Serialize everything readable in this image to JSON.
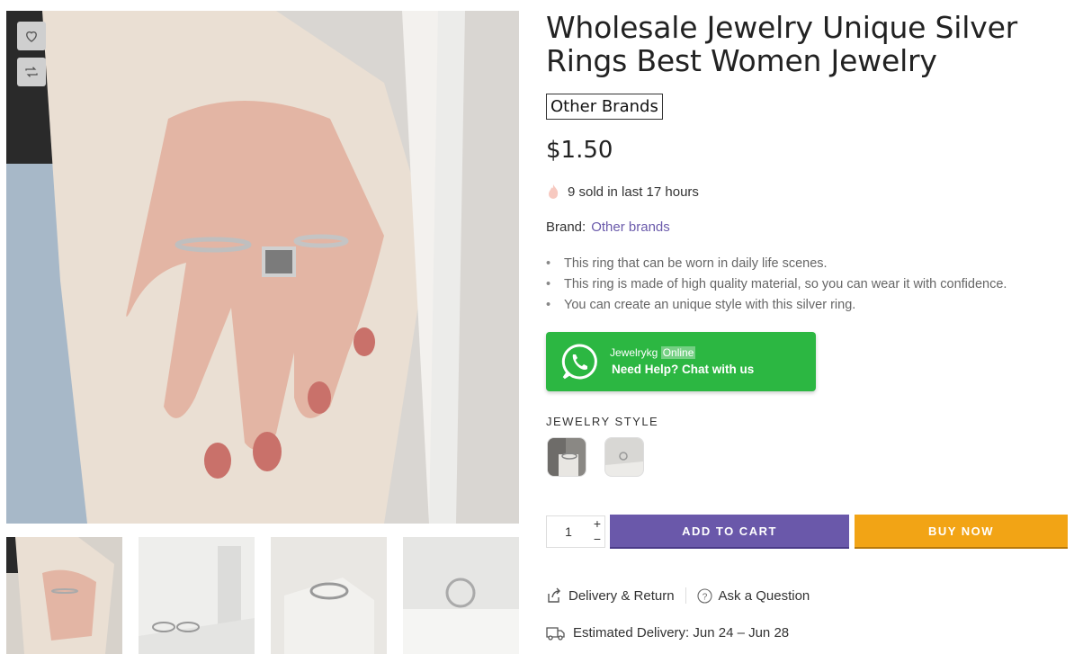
{
  "product": {
    "title": "Wholesale Jewelry Unique Silver Rings Best Women Jewelry",
    "brand_tag": "Other Brands",
    "price": "$1.50",
    "sold_text": "9 sold in last 17 hours",
    "brand_label": "Brand:",
    "brand_link": "Other brands",
    "features": [
      "This ring that can be worn in daily life scenes.",
      "This ring is made of high quality material, so you can wear it with confidence.",
      "You can create an unique style with this silver ring."
    ]
  },
  "whatsapp": {
    "name": "Jewelrykg",
    "status": "Online",
    "cta": "Need Help? Chat with us",
    "color": "#2cb742"
  },
  "variant": {
    "label": "JEWELRY STYLE"
  },
  "purchase": {
    "quantity": "1",
    "plus": "+",
    "minus": "−",
    "add_to_cart": "ADD TO CART",
    "buy_now": "BUY NOW",
    "cart_color": "#6a58aa",
    "buy_color": "#f2a415"
  },
  "links": {
    "delivery_return": "Delivery & Return",
    "ask_question": "Ask a Question"
  },
  "delivery": {
    "text": "Estimated Delivery: Jun 24 – Jun 28"
  },
  "icons": {
    "wishlist": "heart-icon",
    "compare": "compare-icon",
    "fire": "fire-icon",
    "whatsapp": "whatsapp-icon",
    "share": "share-icon",
    "question": "question-icon",
    "truck": "truck-icon"
  }
}
